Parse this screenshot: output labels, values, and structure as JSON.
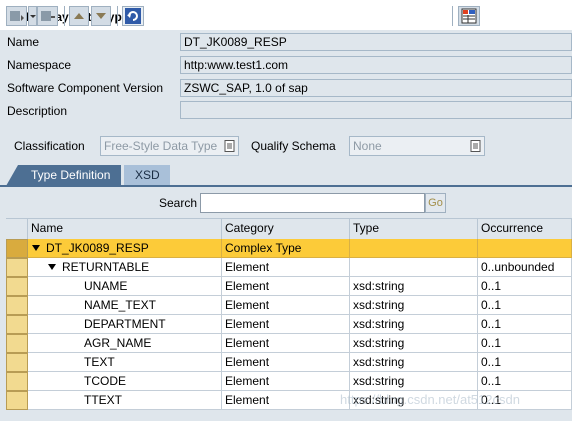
{
  "window": {
    "title": "Display Data Type"
  },
  "form": {
    "name_label": "Name",
    "name_value": "DT_JK0089_RESP",
    "namespace_label": "Namespace",
    "namespace_value": "http:www.test1.com",
    "swcv_label": "Software Component Version",
    "swcv_value": "ZSWC_SAP, 1.0 of sap",
    "description_label": "Description",
    "description_value": "",
    "classification_label": "Classification",
    "classification_value": "Free-Style Data Type",
    "qualify_label": "Qualify Schema",
    "qualify_value": "None"
  },
  "tabs": [
    {
      "label": "Type Definition",
      "active": true
    },
    {
      "label": "XSD",
      "active": false
    }
  ],
  "toolbar": {
    "search_label": "Search",
    "search_value": "",
    "go_label": "Go"
  },
  "table": {
    "columns": [
      "Name",
      "Category",
      "Type",
      "Occurrence"
    ],
    "rows": [
      {
        "name": "DT_JK0089_RESP",
        "category": "Complex Type",
        "type": "",
        "occurrence": "",
        "level": 0,
        "expanded": true,
        "selected": true
      },
      {
        "name": "RETURNTABLE",
        "category": "Element",
        "type": "",
        "occurrence": "0..unbounded",
        "level": 1,
        "expanded": true,
        "selected": false
      },
      {
        "name": "UNAME",
        "category": "Element",
        "type": "xsd:string",
        "occurrence": "0..1",
        "level": 2,
        "selected": false
      },
      {
        "name": "NAME_TEXT",
        "category": "Element",
        "type": "xsd:string",
        "occurrence": "0..1",
        "level": 2,
        "selected": false
      },
      {
        "name": "DEPARTMENT",
        "category": "Element",
        "type": "xsd:string",
        "occurrence": "0..1",
        "level": 2,
        "selected": false
      },
      {
        "name": "AGR_NAME",
        "category": "Element",
        "type": "xsd:string",
        "occurrence": "0..1",
        "level": 2,
        "selected": false
      },
      {
        "name": "TEXT",
        "category": "Element",
        "type": "xsd:string",
        "occurrence": "0..1",
        "level": 2,
        "selected": false
      },
      {
        "name": "TCODE",
        "category": "Element",
        "type": "xsd:string",
        "occurrence": "0..1",
        "level": 2,
        "selected": false
      },
      {
        "name": "TTEXT",
        "category": "Element",
        "type": "xsd:string",
        "occurrence": "0..1",
        "level": 2,
        "selected": false
      }
    ]
  },
  "watermark": "https://blog.csdn.net/at512csdn",
  "colors": {
    "accent": "#4d6f93",
    "selection": "#fccb39",
    "panel": "#dfe6ec"
  }
}
